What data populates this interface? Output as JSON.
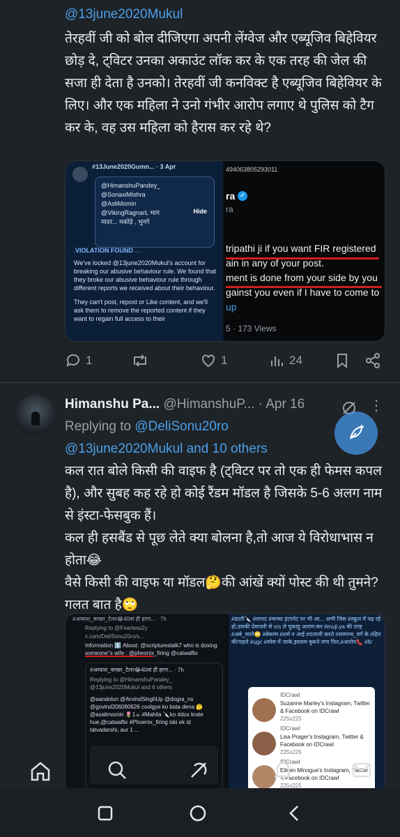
{
  "tweet1": {
    "mention": "@13june2020Mukul",
    "body": "तेरहवीं जी को बोल दीजिएगा अपनी लेंग्वेज और एब्यूजिव बिहेवियर छोड़ दे, ट्विटर उनका अकाउंट लॉक कर के एक तरह की जेल की सजा ही देता है उनको। तेरहवीं जी कनविक्ट है एब्यूजिव बिहेवियर के लिए। और एक महिला ने उनो गंभीर आरोप लगाए थे पुलिस को टैग कर के, वह उस महिला को हैरास कर रहे थे?",
    "media": {
      "left_header": "#13June2020Gumn... · 3 Apr",
      "mentions": [
        "@HimanshuPandey_",
        "@SonaxiMishra",
        "@AsliMomin",
        "@VikingRagnarL भाग",
        "मादर... मकोड़े , भुनगे"
      ],
      "hide": "Hide",
      "violation": "VIOLATION FOUND",
      "violation_text": "We've locked @13june2020Mukul's account for breaking our abusive behaviour rule. We found that they broke our abusive behaviour rule through different reports we received about their behaviour.",
      "violation_text2": "They can't post, repost or Like content, and we'll ask them to remove the reported content if they want to regain full access to their",
      "right_top": "494063805293011",
      "right_name": "ra",
      "right_sub": "ra",
      "right_lines": [
        "tripathi ji if you want FIR registered",
        "ain in any of your post.",
        "ment is done from your side by you",
        "gainst you even if I have to come to",
        "up"
      ],
      "right_views": "5 · 173 Views"
    },
    "actions": {
      "replies": "1",
      "likes": "1",
      "views": "24"
    }
  },
  "tweet2": {
    "name": "Himanshu Pa...",
    "handle": "@HimanshuP...",
    "date": "· Apr 16",
    "replying_prefix": "Replying to ",
    "replying_to": "@DeliSonu20ro",
    "replying_others": "@13june2020Mukul and 10 others",
    "body": "कल रात बोले किसी की वाइफ है (ट्विटर पर तो एक ही फेमस कपल है), और सुबह कह रहे हो कोई रैंडम मॉडल है जिसके 5-6 अलग नाम से इंस्टा-फेसबुक हैं।\nकल ही हसबैंड से पूछ लेते क्या बोलना है,तो आज ये विरोधाभास न होता😂\nवैसे किसी की वाइफ या मॉडल🤔की आंखें क्यों पोस्ट की थी तुमने? गलत बात है🙄",
    "media": {
      "left_top": "#अय्याश_कच्छा_टेलर😂40वां ही हागा... · 7h",
      "left_reply": "Replying to @Fearless2y",
      "left_url": "x.com/DeliSonu20ro/s...",
      "left_info": "Information ℹ️ About: @scripturestalk7 who is doxing someone\"s wife : @pheonix_firing @catwaflix",
      "left_quote_head": "#अय्याश_कच्छा_टेलर😂40वां ही हागा... · 7h",
      "left_quote_reply": "Replying to @HimanshuPandey_",
      "left_quote_reply2": "@13june2020Mukul and 6 others",
      "left_quote_body": "@aandolun @ArvindSinghUp @dogra_ns @govind206080626 coolgye ko bata dena 🤔 @asalimomin 🌷1☕ #Mahila 🔪ko #dox krate hue,@catwaflix #Phoenix_firing iski ek id tatvadarshi, aur 1 ...",
      "right_hashtags": "#ढाली🔪 #लगाट #कच्चा इंटरनेट पर भी आ... अभी जिस #स्कूल में पढ़ रहे हो,उसकी प्रेसपली से vrs ले चुकाहू आराम:कर #muji.ya की तरह #अबे_साले🙄 #बेसरम #शर्म न आई #दलाली करते #सामान्य_वर्ग के #हित की!पहले #ugc #स्पेस में जाके,इस्लाम बुकने लगा फिर,#आरोप👠 #fir",
      "cards": [
        {
          "label": "IDCrawl",
          "title": "Suzanne Marley's Instagram, Twitter & Facebook on IDCrawl",
          "size": "225x225"
        },
        {
          "label": "IDCrawl",
          "title": "Lisa Prager's Instagram, Twitter & Facebook on IDCrawl",
          "size": "225x225"
        },
        {
          "label": "IDCrawl",
          "title": "Eileen Minogue's Instagram, Twitter & Facebook on IDCrawl",
          "size": "225x225"
        }
      ]
    }
  },
  "colors": {
    "background": "#1e2328",
    "link": "#4c9fe8",
    "muted": "#9aa0a6"
  }
}
